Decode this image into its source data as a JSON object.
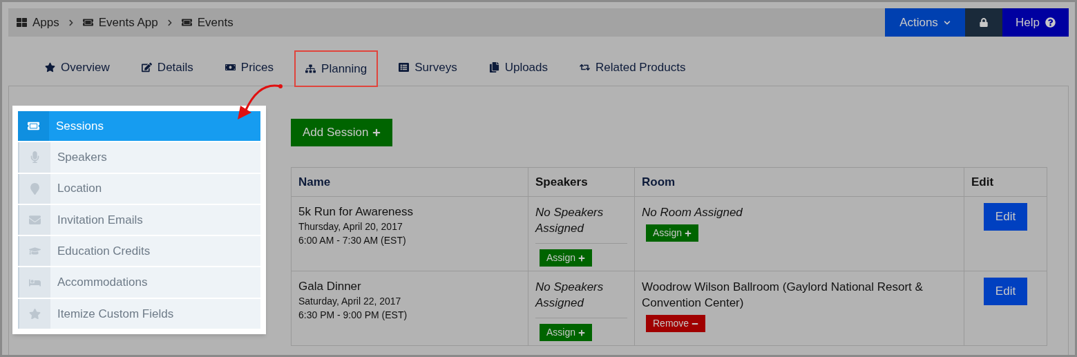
{
  "breadcrumbs": [
    "Apps",
    "Events App",
    "Events"
  ],
  "header_buttons": {
    "actions": "Actions",
    "help": "Help"
  },
  "tabs": [
    {
      "label": "Overview",
      "selected": false
    },
    {
      "label": "Details",
      "selected": false
    },
    {
      "label": "Prices",
      "selected": false
    },
    {
      "label": "Planning",
      "selected": true
    },
    {
      "label": "Surveys",
      "selected": false
    },
    {
      "label": "Uploads",
      "selected": false
    },
    {
      "label": "Related Products",
      "selected": false
    }
  ],
  "sidebar": {
    "items": [
      {
        "label": "Sessions",
        "selected": true
      },
      {
        "label": "Speakers",
        "selected": false
      },
      {
        "label": "Location",
        "selected": false
      },
      {
        "label": "Invitation Emails",
        "selected": false
      },
      {
        "label": "Education Credits",
        "selected": false
      },
      {
        "label": "Accommodations",
        "selected": false
      },
      {
        "label": "Itemize Custom Fields",
        "selected": false
      }
    ]
  },
  "add_button": "Add Session",
  "table": {
    "columns": [
      "Name",
      "Speakers",
      "Room",
      "Edit"
    ],
    "rows": [
      {
        "name": "5k Run for Awareness",
        "date": "Thursday, April 20, 2017",
        "time": "6:00 AM - 7:30 AM (EST)",
        "speakers": "No Speakers Assigned",
        "speaker_button": "Assign",
        "room": "No Room Assigned",
        "room_assigned": false,
        "room_button": "Assign",
        "edit": "Edit"
      },
      {
        "name": "Gala Dinner",
        "date": "Saturday, April 22, 2017",
        "time": "6:30 PM - 9:00 PM (EST)",
        "speakers": "No Speakers Assigned",
        "speaker_button": "Assign",
        "room": "Woodrow Wilson Ballroom (Gaylord National Resort & Convention Center)",
        "room_assigned": true,
        "room_button": "Remove",
        "edit": "Edit"
      }
    ]
  }
}
